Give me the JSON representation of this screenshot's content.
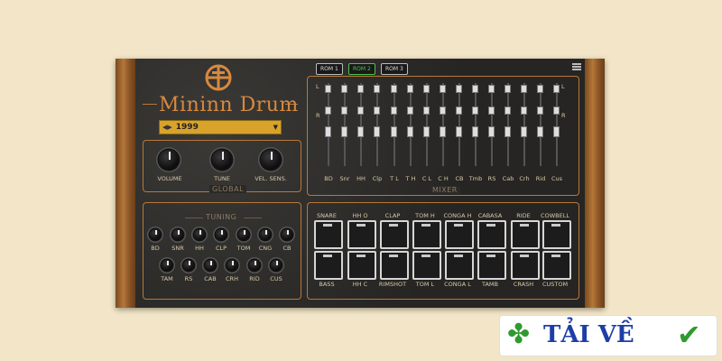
{
  "plugin": {
    "brand_part1": "Mininn",
    "brand_part2": "Drum",
    "preset_value": "1999",
    "rom_buttons": [
      "ROM 1",
      "ROM 2",
      "ROM 3"
    ],
    "rom_active_index": 1
  },
  "global": {
    "title": "GLOBAL",
    "knobs": [
      "VOLUME",
      "TUNE",
      "VEL. SENS."
    ]
  },
  "mixer": {
    "title": "MIXER",
    "channels": [
      "BD",
      "Snr",
      "HH",
      "Clp",
      "T L",
      "T H",
      "C L",
      "C H",
      "CB",
      "Tmb",
      "RS",
      "Cab",
      "Crh",
      "Rid",
      "Cus"
    ],
    "side_labels": {
      "top_left": "L",
      "top_right": "L",
      "mid_left": "R",
      "mid_right": "R"
    }
  },
  "tuning": {
    "title": "TUNING",
    "row1": [
      "BD",
      "SNR",
      "HH",
      "CLP",
      "TOM",
      "CNG",
      "CB"
    ],
    "row2": [
      "TAM",
      "RS",
      "CAB",
      "CRH",
      "RID",
      "CUS"
    ]
  },
  "pads": {
    "top_labels": [
      "SNARE",
      "HH O",
      "CLAP",
      "TOM H",
      "CONGA H",
      "CABASA",
      "RIDE",
      "COWBELL"
    ],
    "bottom_labels": [
      "BASS",
      "HH C",
      "RIMSHOT",
      "TOM L",
      "CONGA L",
      "TAMB",
      "CRASH",
      "CUSTOM"
    ]
  },
  "watermark": {
    "text": "TẢI VỀ"
  },
  "colors": {
    "accent": "#d7893f",
    "rom_active": "#4ec24e",
    "preset_bg": "#d9a22a"
  }
}
